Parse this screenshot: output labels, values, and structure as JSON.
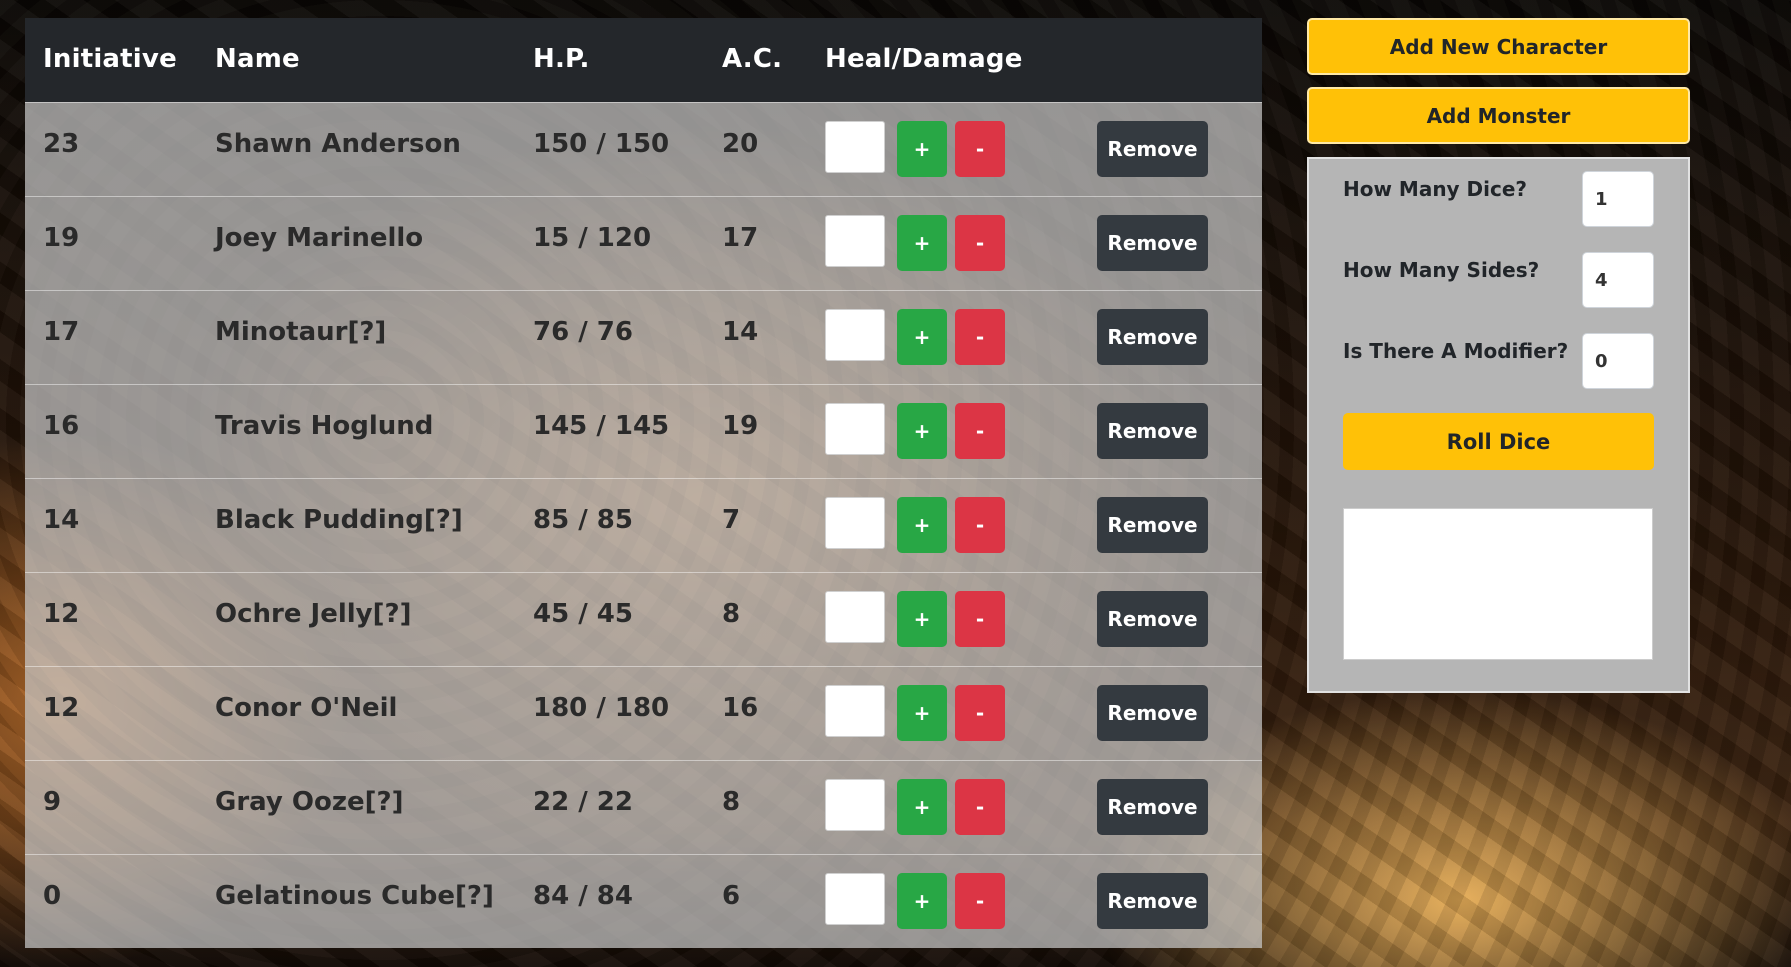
{
  "table": {
    "headers": {
      "initiative": "Initiative",
      "name": "Name",
      "hp": "H.P.",
      "ac": "A.C.",
      "heal_damage": "Heal/Damage"
    },
    "plus_label": "+",
    "minus_label": "-",
    "remove_label": "Remove",
    "rows": [
      {
        "initiative": "23",
        "name": "Shawn Anderson",
        "hp": "150 / 150",
        "ac": "20"
      },
      {
        "initiative": "19",
        "name": "Joey Marinello",
        "hp": "15 / 120",
        "ac": "17"
      },
      {
        "initiative": "17",
        "name": "Minotaur[?]",
        "hp": "76 / 76",
        "ac": "14"
      },
      {
        "initiative": "16",
        "name": "Travis Hoglund",
        "hp": "145 / 145",
        "ac": "19"
      },
      {
        "initiative": "14",
        "name": "Black Pudding[?]",
        "hp": "85 / 85",
        "ac": "7"
      },
      {
        "initiative": "12",
        "name": "Ochre Jelly[?]",
        "hp": "45 / 45",
        "ac": "8"
      },
      {
        "initiative": "12",
        "name": "Conor O'Neil",
        "hp": "180 / 180",
        "ac": "16"
      },
      {
        "initiative": "9",
        "name": "Gray Ooze[?]",
        "hp": "22 / 22",
        "ac": "8"
      },
      {
        "initiative": "0",
        "name": "Gelatinous Cube[?]",
        "hp": "84 / 84",
        "ac": "6"
      }
    ]
  },
  "sidebar": {
    "add_character_label": "Add New Character",
    "add_monster_label": "Add Monster",
    "dice": {
      "dice_count_label": "How Many Dice?",
      "dice_count_value": "1",
      "sides_label": "How Many Sides?",
      "sides_value": "4",
      "modifier_label": "Is There A Modifier?",
      "modifier_value": "0",
      "roll_label": "Roll Dice",
      "result": ""
    }
  },
  "colors": {
    "header_bg": "#24272b",
    "plus": "#28a745",
    "minus": "#dc3545",
    "remove": "#343a40",
    "accent": "#ffc107"
  }
}
